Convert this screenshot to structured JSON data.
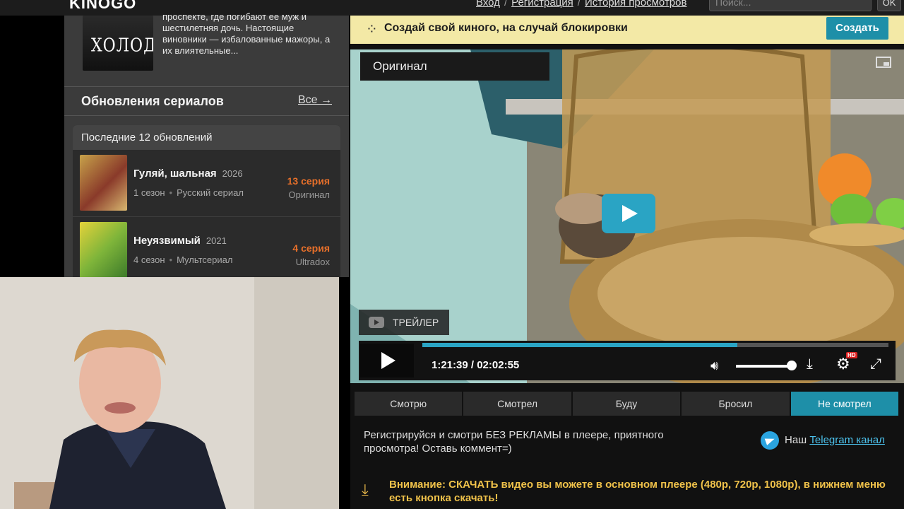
{
  "header": {
    "logo": "KINOGO",
    "links": [
      "Вход",
      "Регистрация",
      "История просмотров"
    ],
    "link_separator": "/",
    "search_placeholder": "Поиск...",
    "search_button": "OK"
  },
  "featured": {
    "poster_title": "ХОЛОД",
    "description": "проспекте, где погибают ее муж и шестилетняя дочь. Настоящие виновники — избалованные мажоры, а их влиятельные..."
  },
  "series_updates": {
    "title": "Обновления сериалов",
    "all_link": "Все →",
    "panel_title": "Последние 12 обновлений",
    "items": [
      {
        "name": "Гуляй, шальная",
        "year": "2026",
        "season": "1 сезон",
        "category": "Русский сериал",
        "episode": "13 серия",
        "source": "Оригинал"
      },
      {
        "name": "Неуязвимый",
        "year": "2021",
        "season": "4 сезон",
        "category": "Мультсериал",
        "episode": "4 серия",
        "source": "Ultradox"
      }
    ],
    "meta_dot": "•"
  },
  "banner": {
    "text": "Создай свой киного, на случай блокировки",
    "button": "Создать"
  },
  "player": {
    "voice_tab": "Оригинал",
    "trailer_label": "ТРЕЙЛЕР",
    "current_time": "1:21:39",
    "total_time": "02:02:55",
    "time_separator": "/",
    "progress": 0.675,
    "volume": 0.9,
    "quality_badge": "HD",
    "accent_color": "#2aa4c4"
  },
  "status_buttons": [
    "Смотрю",
    "Смотрел",
    "Буду",
    "Бросил",
    "Не смотрел"
  ],
  "status_active_index": 4,
  "promo": {
    "text": "Регистрируйся и смотри БЕЗ РЕКЛАМЫ в плеере, приятного просмотра! Оставь коммент=)",
    "telegram_prefix": "Наш",
    "telegram_link": "Telegram канал"
  },
  "warning": {
    "text": "Внимание: СКАЧАТЬ видео вы можете в основном плеере (480p, 720p, 1080p), в нижнем меню есть кнопка скачать!"
  }
}
